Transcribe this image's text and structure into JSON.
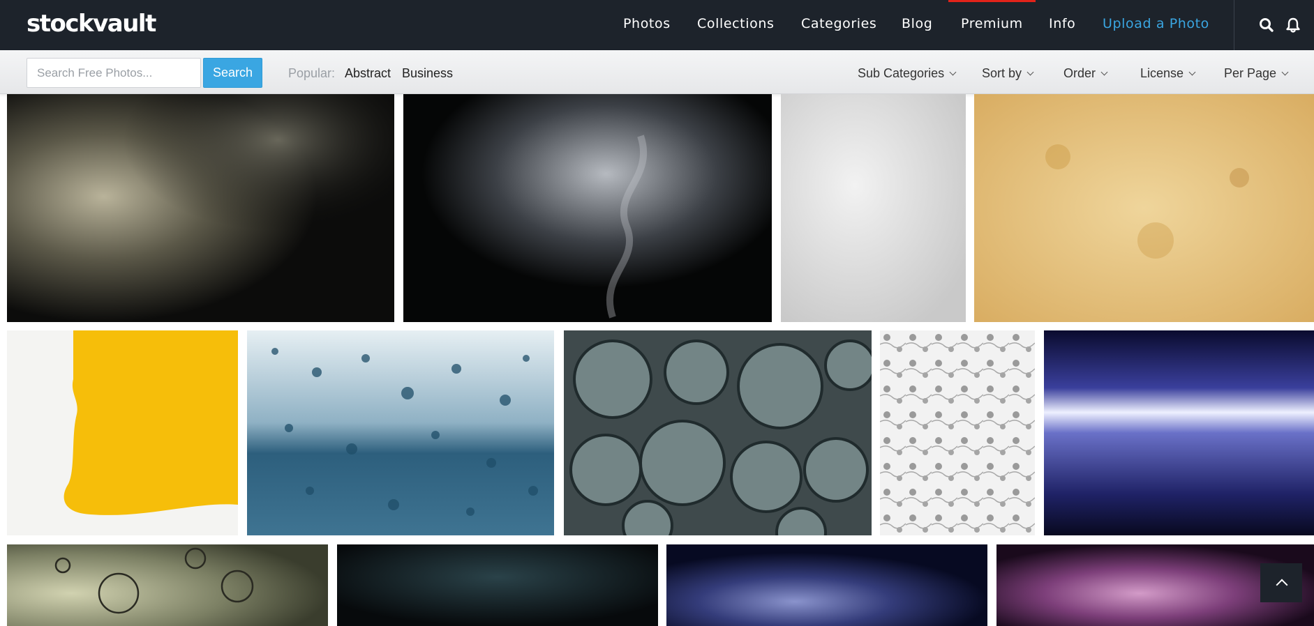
{
  "brand": {
    "logo_text": "stockvault"
  },
  "nav": {
    "items": [
      "Photos",
      "Collections",
      "Categories",
      "Blog",
      "Premium",
      "Info"
    ],
    "upload_label": "Upload a Photo",
    "icons": [
      "search-icon",
      "bell-icon"
    ],
    "accent_color": "#3aa6e2",
    "active_marker_color": "#e2231a"
  },
  "search": {
    "placeholder": "Search Free Photos...",
    "button_label": "Search"
  },
  "popular": {
    "label": "Popular:",
    "links": [
      "Abstract",
      "Business"
    ]
  },
  "filters": [
    "Sub Categories",
    "Sort by",
    "Order",
    "License",
    "Per Page"
  ],
  "gallery": {
    "rows": [
      [
        "smoke-dark-photo",
        "smoke-grey-photo",
        "grey-texture-photo",
        "parchment-texture-photo"
      ],
      [
        "yellow-paint-photo",
        "water-drops-photo",
        "bubbles-photo",
        "floral-pattern-photo",
        "blue-light-streak-photo"
      ],
      [
        "bubbles-green-photo",
        "smoke-teal-photo",
        "smoke-blue-photo",
        "smoke-purple-photo"
      ]
    ]
  },
  "back_to_top_icon": "chevron-up-icon"
}
